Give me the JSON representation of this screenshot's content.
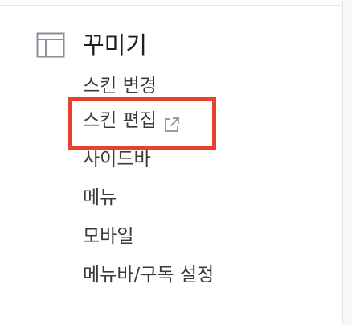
{
  "section": {
    "icon": "layout-icon",
    "title": "꾸미기"
  },
  "menu": {
    "items": [
      {
        "label": "스킨 변경"
      },
      {
        "label": "스킨 편집",
        "icon": "external-link-icon"
      },
      {
        "label": "사이드바"
      },
      {
        "label": "메뉴"
      },
      {
        "label": "모바일"
      },
      {
        "label": "메뉴바/구독 설정"
      }
    ]
  },
  "colors": {
    "highlight": "#e8432a",
    "text": "#3a3a3a",
    "title": "#1f1f1f",
    "icon": "#8a8f99"
  }
}
